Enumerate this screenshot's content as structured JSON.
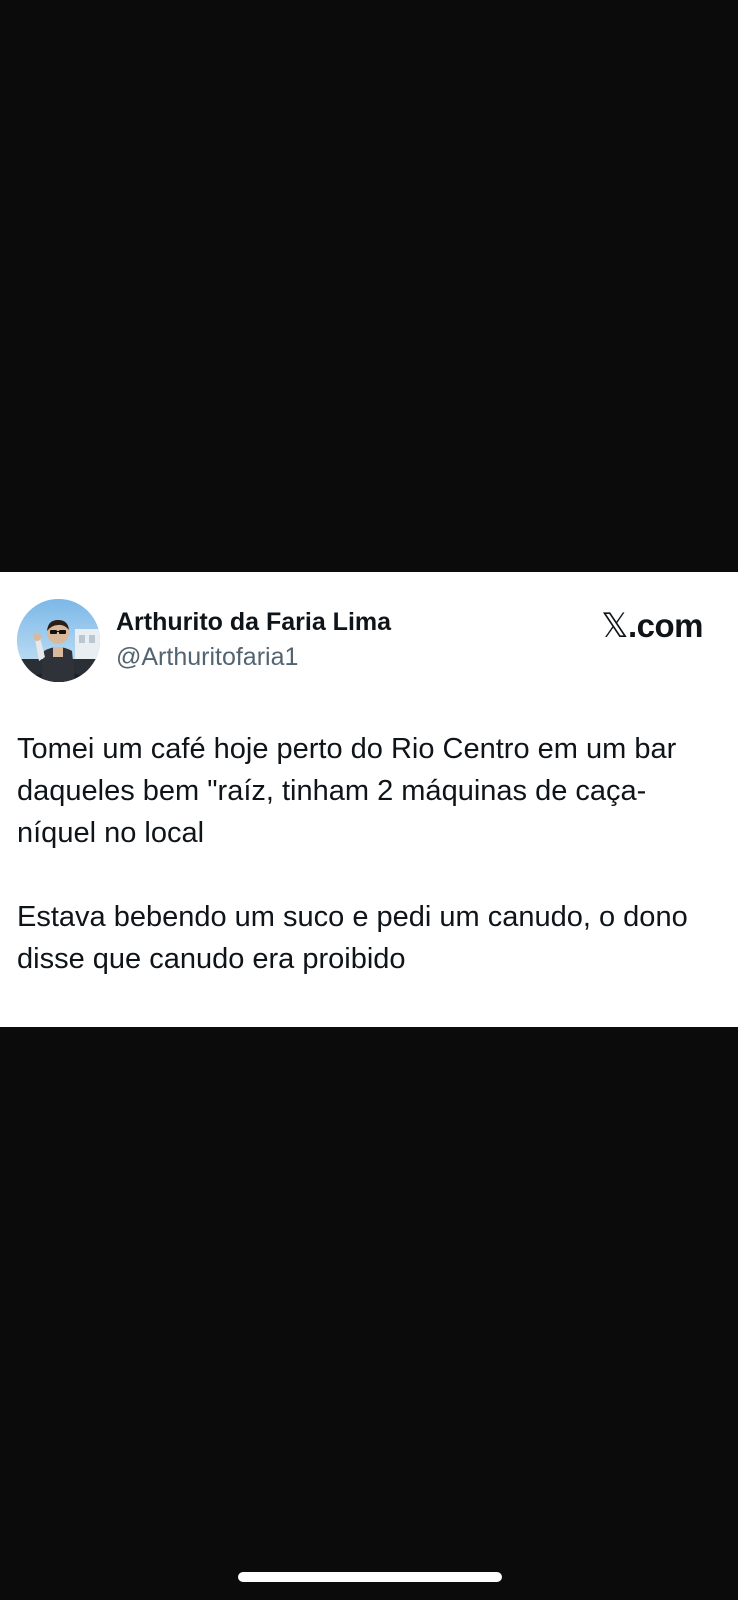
{
  "tweet": {
    "author_name": "Arthurito da Faria Lima",
    "author_handle": "@Arthuritofaria1",
    "brand_x": "𝕏",
    "brand_domain": ".com",
    "paragraph_1": "Tomei um café hoje perto do Rio Centro em um bar daqueles bem \"raíz, tinham 2 máquinas de caça-níquel no local",
    "paragraph_2": "Estava bebendo um suco e pedi um canudo, o dono disse que canudo era proibido"
  },
  "colors": {
    "background": "#0b0b0b",
    "card": "#ffffff",
    "text_primary": "#0f1419",
    "text_secondary": "#536471"
  },
  "icons": {
    "avatar": "profile-photo-avatar",
    "brand": "x-logo-icon",
    "home_indicator": "home-indicator-bar"
  }
}
